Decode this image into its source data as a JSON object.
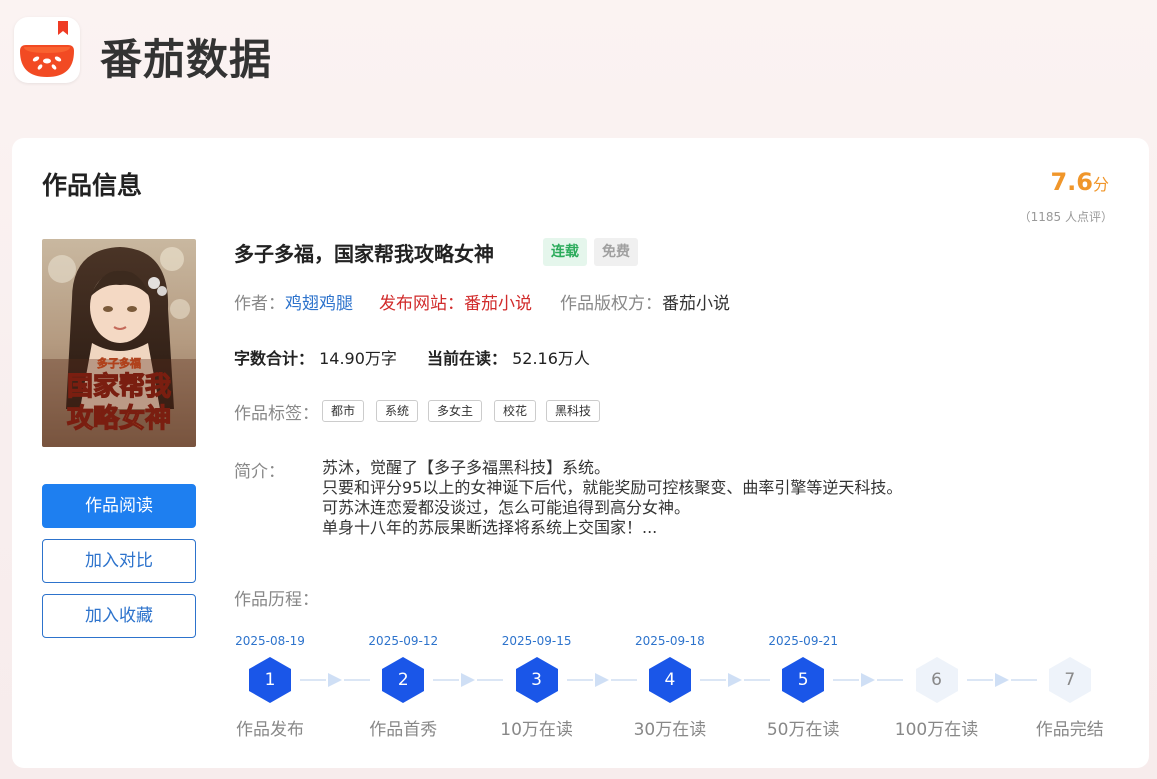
{
  "brand": {
    "name": "番茄数据",
    "logo_icon": "tomato-logo-icon"
  },
  "card": {
    "title": "作品信息"
  },
  "score": {
    "value": "7.6",
    "unit": "分",
    "count_text": "（1185 人点评）"
  },
  "cover": {
    "text_line1": "多子多福",
    "text_line2": "国家帮我",
    "text_line3": "攻略女神"
  },
  "actions": {
    "read": "作品阅读",
    "compare": "加入对比",
    "favorite": "加入收藏"
  },
  "book": {
    "title": "多子多福，国家帮我攻略女神",
    "status_badge": "连载",
    "price_badge": "免费",
    "author_label": "作者：",
    "author": "鸡翅鸡腿",
    "site_label": "发布网站：",
    "site": "番茄小说",
    "copyright_label": "作品版权方：",
    "copyright": "番茄小说",
    "word_count_label": "字数合计：",
    "word_count": "14.90万字",
    "readers_label": "当前在读：",
    "readers": "52.16万人",
    "tags_label": "作品标签：",
    "tags": [
      "都市",
      "系统",
      "多女主",
      "校花",
      "黑科技"
    ],
    "intro_label": "简介：",
    "intro_lines": [
      "苏沐，觉醒了【多子多福黑科技】系统。",
      "只要和评分95以上的女神诞下后代，就能奖励可控核聚变、曲率引擎等逆天科技。",
      "可苏沐连恋爱都没谈过，怎么可能追得到高分女神。",
      "单身十八年的苏辰果断选择将系统上交国家！..."
    ]
  },
  "history": {
    "label": "作品历程：",
    "steps": [
      {
        "num": "1",
        "date": "2025-08-19",
        "label": "作品发布",
        "done": true
      },
      {
        "num": "2",
        "date": "2025-09-12",
        "label": "作品首秀",
        "done": true
      },
      {
        "num": "3",
        "date": "2025-09-15",
        "label": "10万在读",
        "done": true
      },
      {
        "num": "4",
        "date": "2025-09-18",
        "label": "30万在读",
        "done": true
      },
      {
        "num": "5",
        "date": "2025-09-21",
        "label": "50万在读",
        "done": true
      },
      {
        "num": "6",
        "date": "",
        "label": "100万在读",
        "done": false
      },
      {
        "num": "7",
        "date": "",
        "label": "作品完结",
        "done": false
      }
    ]
  },
  "colors": {
    "accent": "#1e7ff0",
    "timeline_done": "#1a56e8",
    "timeline_todo": "#eef3fa",
    "score": "#f0962a"
  }
}
